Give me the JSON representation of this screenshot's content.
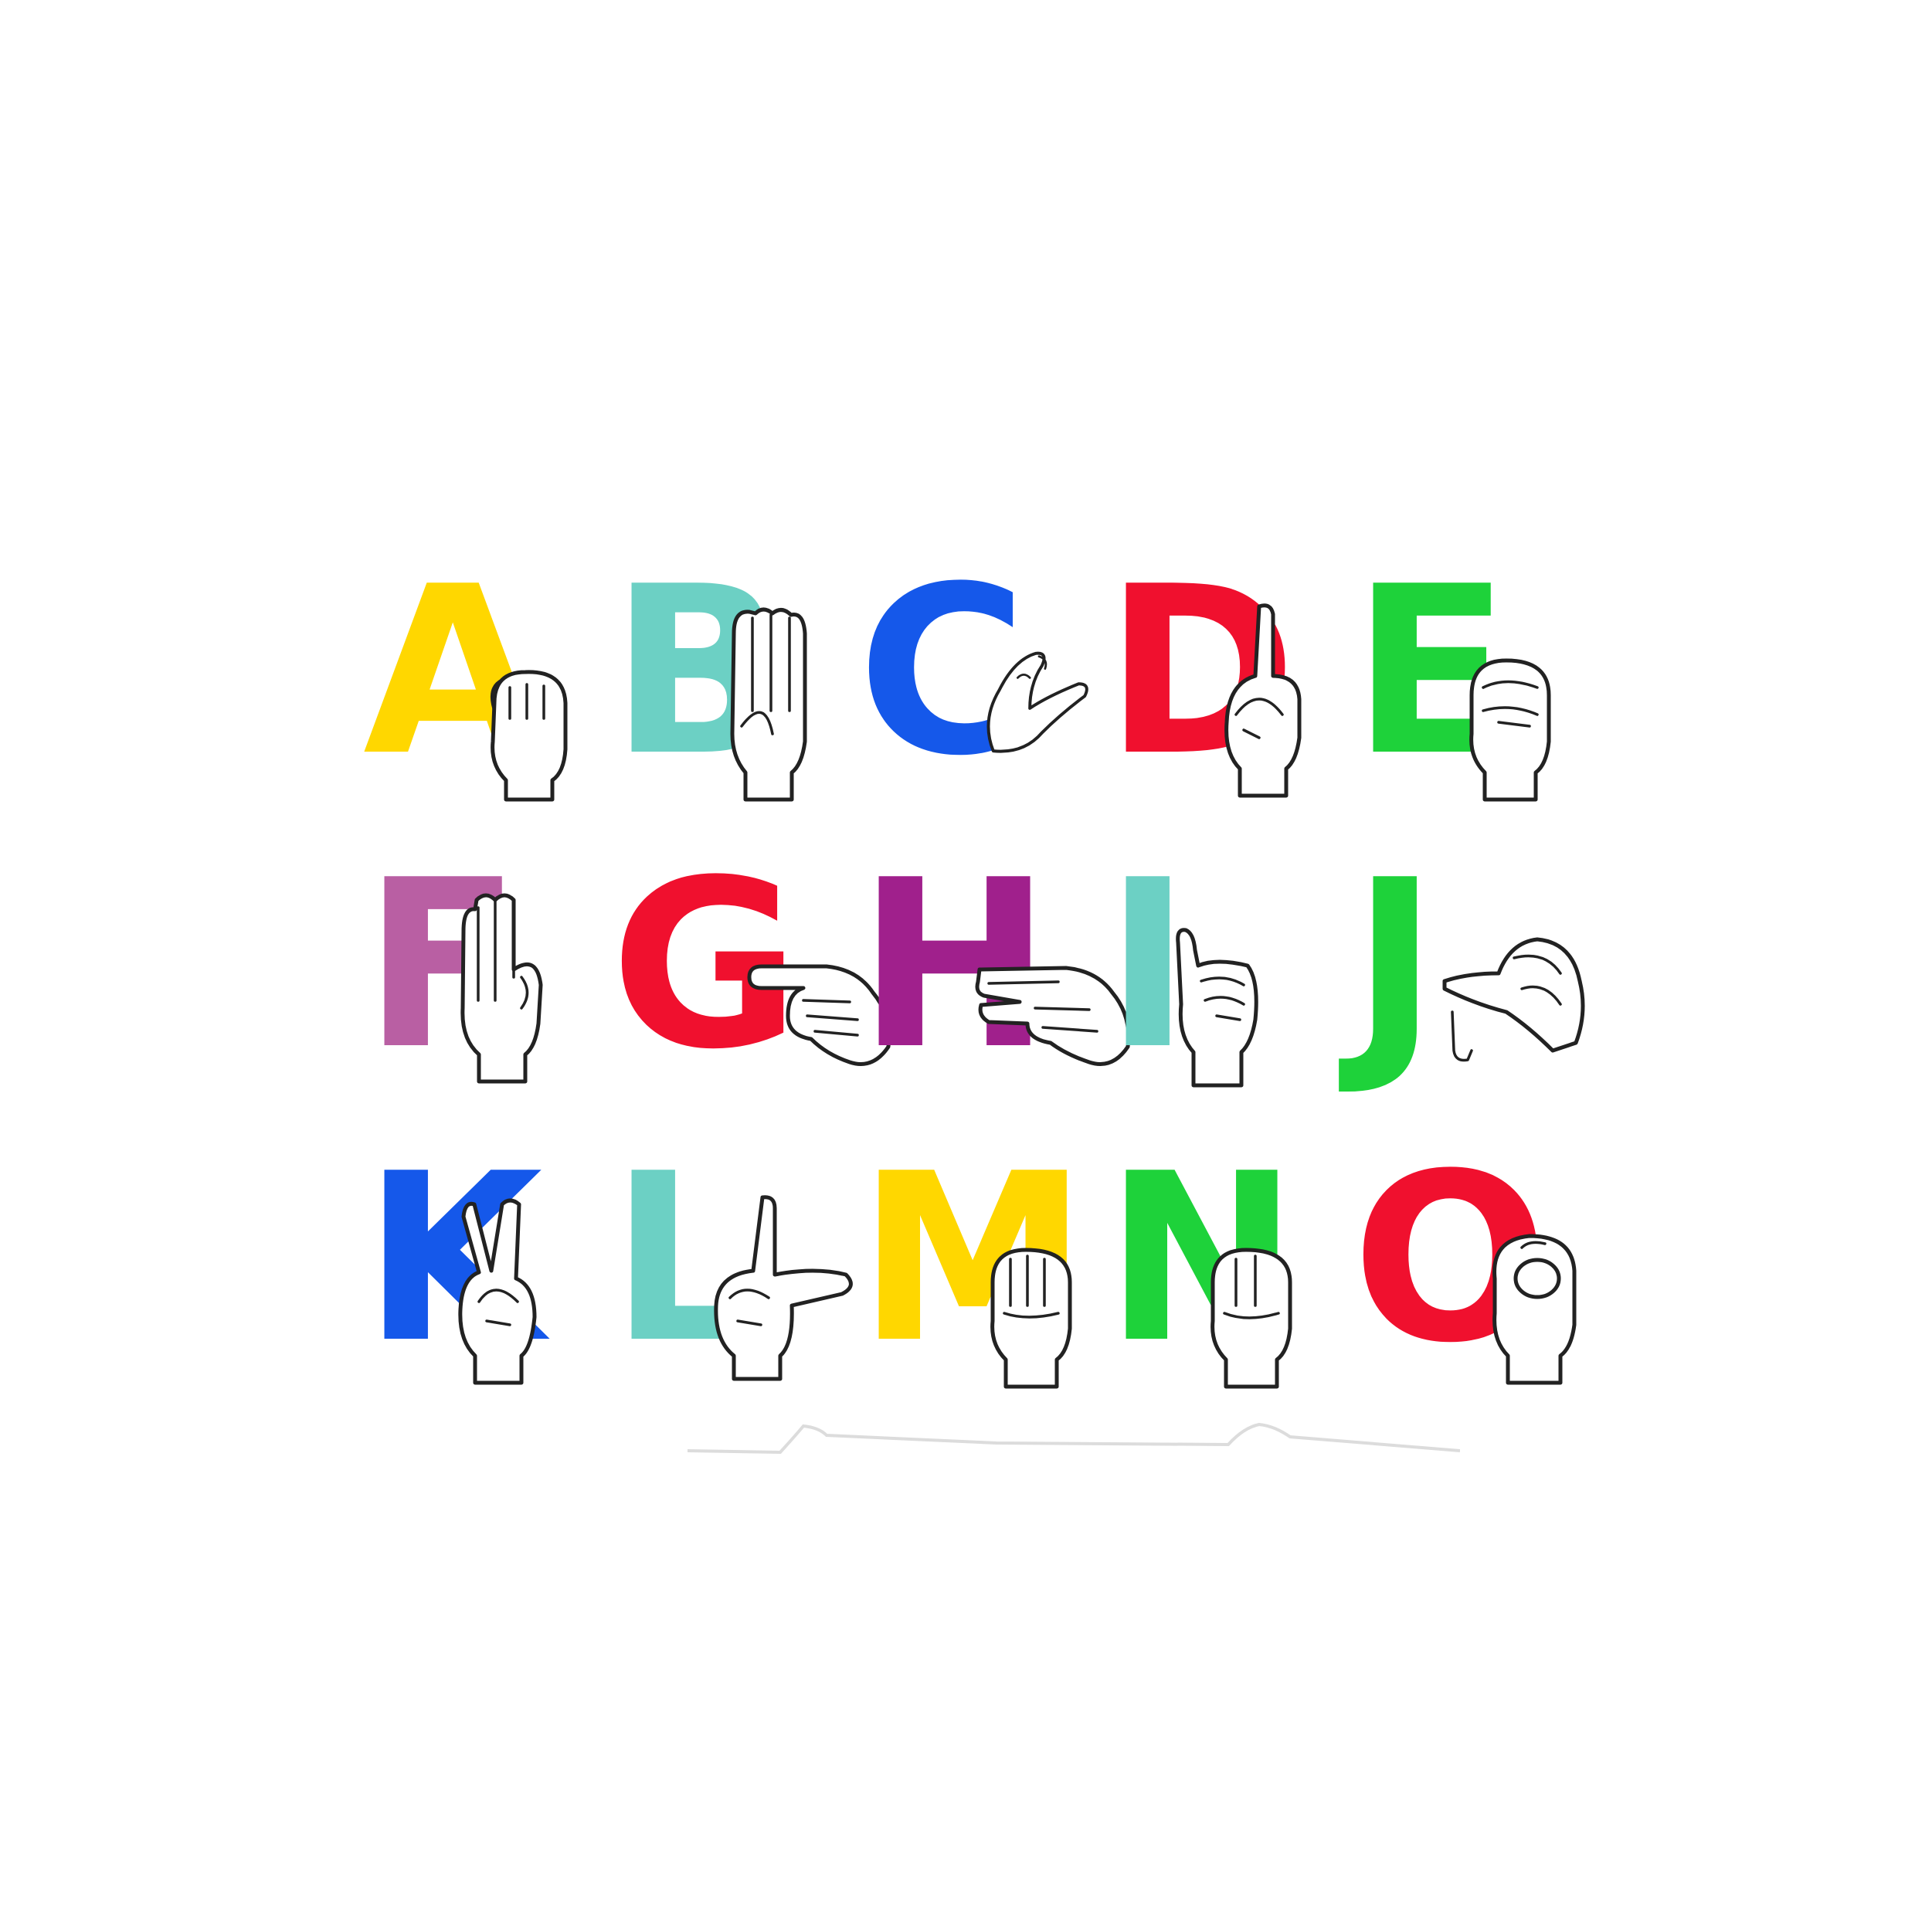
{
  "colors": {
    "yellow": "#FFD700",
    "teal": "#6CD0C4",
    "blue": "#1558EA",
    "red": "#F0102E",
    "green": "#1ED23A",
    "pink_purple": "#B95FA3",
    "purple": "#A0208C"
  },
  "letters": [
    {
      "char": "A",
      "color": "#FFD700",
      "hand": "fist-thumb-side-icon"
    },
    {
      "char": "B",
      "color": "#6CD0C4",
      "hand": "flat-hand-icon"
    },
    {
      "char": "C",
      "color": "#1558EA",
      "hand": "c-curve-hand-icon"
    },
    {
      "char": "D",
      "color": "#F0102E",
      "hand": "index-up-hand-icon"
    },
    {
      "char": "E",
      "color": "#1ED23A",
      "hand": "curled-fist-icon"
    },
    {
      "char": "F",
      "color": "#B95FA3",
      "hand": "three-fingers-up-icon"
    },
    {
      "char": "G",
      "color": "#F0102E",
      "hand": "index-point-side-icon"
    },
    {
      "char": "H",
      "color": "#A0208C",
      "hand": "two-fingers-side-icon"
    },
    {
      "char": "I",
      "color": "#6CD0C4",
      "hand": "pinky-up-icon"
    },
    {
      "char": "J",
      "color": "#1ED23A",
      "hand": "pinky-j-motion-icon"
    },
    {
      "char": "K",
      "color": "#1558EA",
      "hand": "k-two-fingers-icon"
    },
    {
      "char": "L",
      "color": "#6CD0C4",
      "hand": "l-shape-hand-icon"
    },
    {
      "char": "M",
      "color": "#FFD700",
      "hand": "fist-m-icon"
    },
    {
      "char": "N",
      "color": "#1ED23A",
      "hand": "fist-n-icon"
    },
    {
      "char": "O",
      "color": "#F0102E",
      "hand": "o-shape-hand-icon"
    }
  ]
}
